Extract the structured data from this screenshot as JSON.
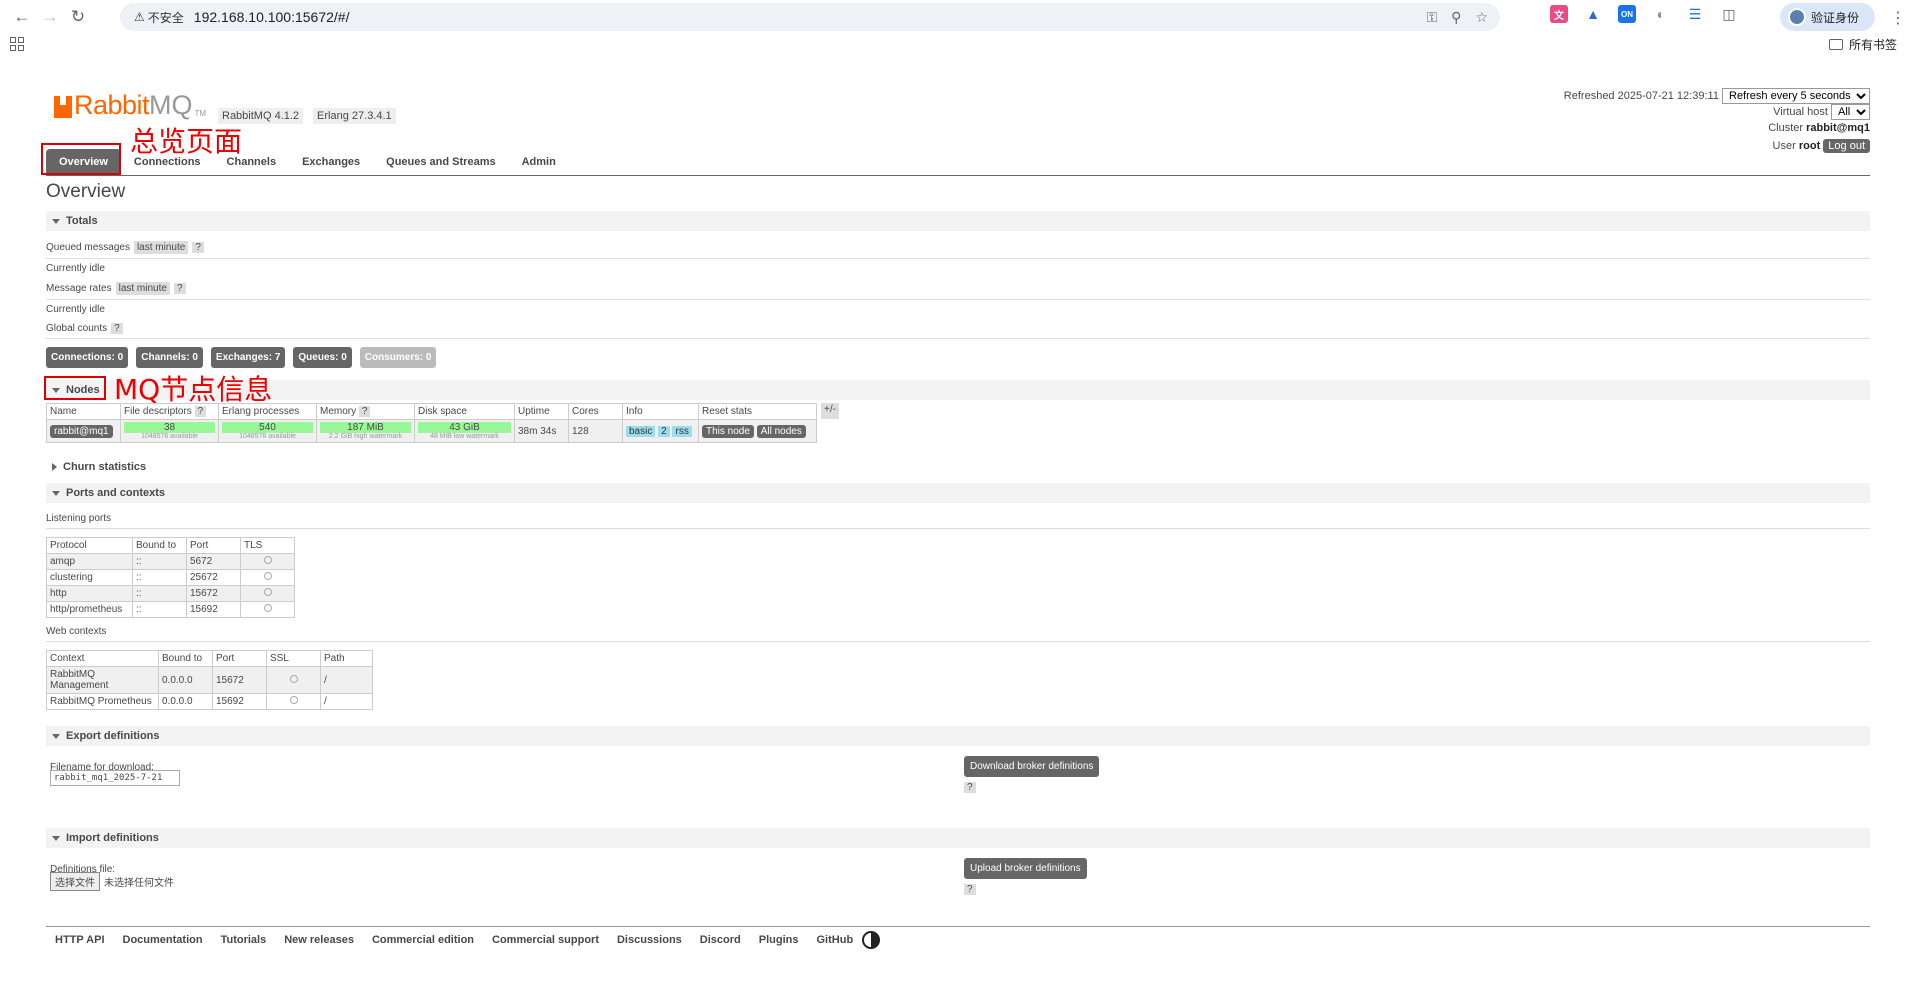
{
  "browser": {
    "insecure_label": "不安全",
    "url": "192.168.10.100:15672/#/",
    "verify_label": "验证身份",
    "bookmarks_all": "所有书签"
  },
  "header": {
    "logo_rabbit": "Rabbit",
    "logo_mq": "MQ",
    "logo_tm": "TM",
    "version_rabbit": "RabbitMQ 4.1.2",
    "version_erlang": "Erlang 27.3.4.1",
    "refreshed": "Refreshed 2025-07-21 12:39:11",
    "refresh_option": "Refresh every 5 seconds",
    "vhost_label": "Virtual host",
    "vhost_value": "All",
    "cluster_label": "Cluster",
    "cluster_value": "rabbit@mq1",
    "user_label": "User",
    "user_value": "root",
    "logout": "Log out"
  },
  "annotations": {
    "overview": "总览页面",
    "nodes": "MQ节点信息"
  },
  "tabs": [
    "Overview",
    "Connections",
    "Channels",
    "Exchanges",
    "Queues and Streams",
    "Admin"
  ],
  "page_title": "Overview",
  "totals": {
    "title": "Totals",
    "queued_messages": "Queued messages",
    "last_minute": "last minute",
    "help": "?",
    "idle1": "Currently idle",
    "message_rates": "Message rates",
    "idle2": "Currently idle",
    "global_counts": "Global counts"
  },
  "counts": {
    "connections": "Connections: 0",
    "channels": "Channels: 0",
    "exchanges": "Exchanges: 7",
    "queues": "Queues: 0",
    "consumers": "Consumers: 0"
  },
  "nodes": {
    "title": "Nodes",
    "headers": [
      "Name",
      "File descriptors",
      "Erlang processes",
      "Memory",
      "Disk space",
      "Uptime",
      "Cores",
      "Info",
      "Reset stats"
    ],
    "toggle": "+/-",
    "name": "rabbit@mq1",
    "fd": "38",
    "fd_sub": "1048576 available",
    "erl": "540",
    "erl_sub": "1048576 available",
    "mem": "187 MiB",
    "mem_sub": "2.2 GiB high watermark",
    "disk": "43 GiB",
    "disk_sub": "48 MiB low watermark",
    "uptime": "38m 34s",
    "cores": "128",
    "info_basic": "basic",
    "info_2": "2",
    "info_rss": "rss",
    "reset_this": "This node",
    "reset_all": "All nodes"
  },
  "churn": {
    "title": "Churn statistics"
  },
  "ports": {
    "title": "Ports and contexts",
    "listening_label": "Listening ports",
    "listening_headers": [
      "Protocol",
      "Bound to",
      "Port",
      "TLS"
    ],
    "listening_rows": [
      {
        "protocol": "amqp",
        "bound": "::",
        "port": "5672"
      },
      {
        "protocol": "clustering",
        "bound": "::",
        "port": "25672"
      },
      {
        "protocol": "http",
        "bound": "::",
        "port": "15672"
      },
      {
        "protocol": "http/prometheus",
        "bound": "::",
        "port": "15692"
      }
    ],
    "web_label": "Web contexts",
    "web_headers": [
      "Context",
      "Bound to",
      "Port",
      "SSL",
      "Path"
    ],
    "web_rows": [
      {
        "context": "RabbitMQ Management",
        "bound": "0.0.0.0",
        "port": "15672",
        "path": "/"
      },
      {
        "context": "RabbitMQ Prometheus",
        "bound": "0.0.0.0",
        "port": "15692",
        "path": "/"
      }
    ]
  },
  "export": {
    "title": "Export definitions",
    "filename_label": "Filename for download:",
    "filename_value": "rabbit_mq1_2025-7-21",
    "button": "Download broker definitions",
    "help": "?"
  },
  "import": {
    "title": "Import definitions",
    "file_label": "Definitions file:",
    "choose": "选择文件",
    "no_file": "未选择任何文件",
    "button": "Upload broker definitions",
    "help": "?"
  },
  "footer": [
    "HTTP API",
    "Documentation",
    "Tutorials",
    "New releases",
    "Commercial edition",
    "Commercial support",
    "Discussions",
    "Discord",
    "Plugins",
    "GitHub"
  ]
}
